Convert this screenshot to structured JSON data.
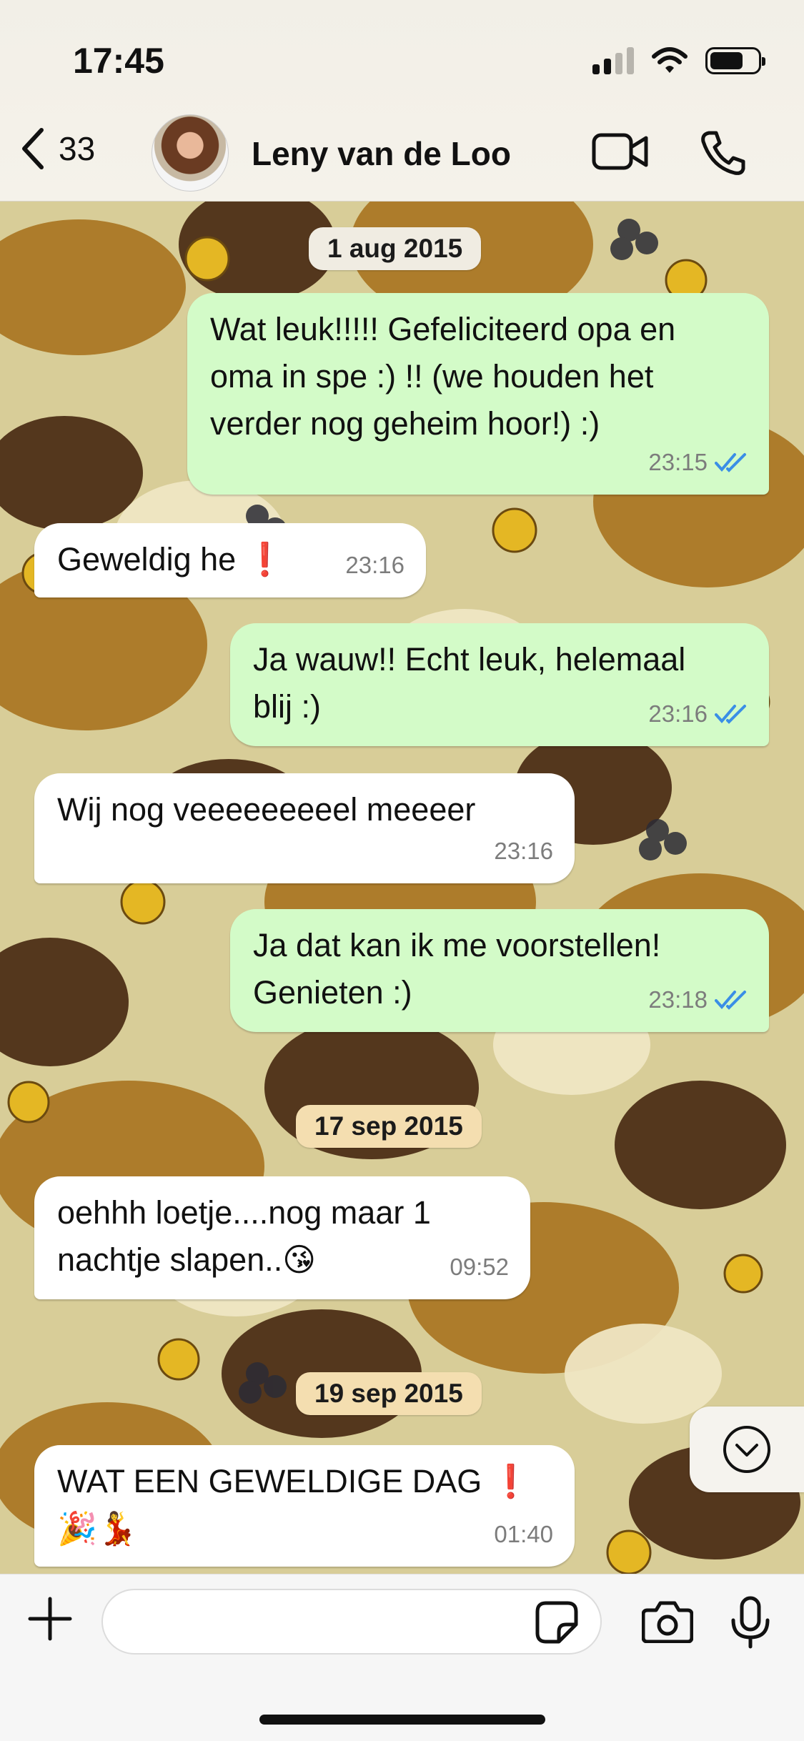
{
  "status_bar": {
    "time": "17:45"
  },
  "header": {
    "back_count": "33",
    "contact_name": "Leny van de Loo"
  },
  "colors": {
    "outgoing_bubble": "#d3fbc8",
    "incoming_bubble": "#ffffff",
    "read_ticks": "#3a8ee6",
    "date_pill_1": "#f0ece2",
    "date_pill_2": "#f4deb0"
  },
  "messages": [
    {
      "type": "date",
      "label": "1 aug 2015"
    },
    {
      "type": "outgoing",
      "text": "Wat leuk!!!!! Gefeliciteerd opa en\noma in spe :) !! (we houden het\nverder nog geheim hoor!) :)",
      "time": "23:15",
      "status_icon": "double-check-read-icon"
    },
    {
      "type": "incoming",
      "text": "Geweldig he ❗",
      "time": "23:16"
    },
    {
      "type": "outgoing",
      "text": "Ja wauw!! Echt leuk, helemaal\nblij :)",
      "time": "23:16",
      "status_icon": "double-check-read-icon"
    },
    {
      "type": "incoming",
      "text": "Wij nog veeeeeeeeel meeeer",
      "time": "23:16"
    },
    {
      "type": "outgoing",
      "text": "Ja dat kan ik me voorstellen!\nGenieten :)",
      "time": "23:18",
      "status_icon": "double-check-read-icon"
    },
    {
      "type": "date",
      "label": "17 sep 2015"
    },
    {
      "type": "incoming",
      "text": "oehhh loetje....nog maar 1\nnachtje slapen..😘",
      "time": "09:52"
    },
    {
      "type": "date",
      "label": "19 sep 2015"
    },
    {
      "type": "incoming",
      "text": "WAT EEN GEWELDIGE DAG ❗\n🎉💃",
      "time": "01:40"
    }
  ],
  "input": {
    "placeholder": ""
  },
  "icons": {
    "back": "chevron-left-icon",
    "video": "video-camera-icon",
    "call": "phone-icon",
    "scroll": "chevron-down-circle-icon",
    "attach": "plus-icon",
    "sticker": "sticker-icon",
    "camera": "camera-icon",
    "mic": "microphone-icon"
  }
}
